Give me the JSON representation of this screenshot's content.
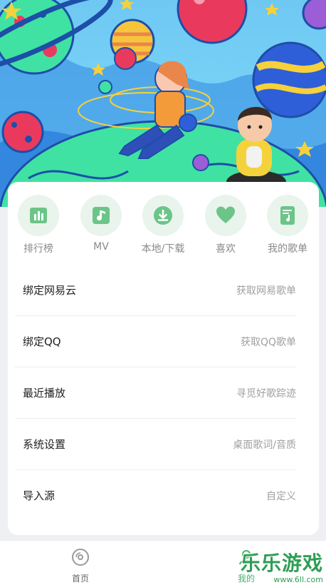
{
  "colors": {
    "accent": "#44b36a",
    "icon_bg": "#e9f4ec"
  },
  "hero": {
    "illustration": "space-planets-girl-and-3d-avatar"
  },
  "shortcuts": [
    {
      "label": "排行榜",
      "icon": "chart-icon"
    },
    {
      "label": "MV",
      "icon": "music-note-icon"
    },
    {
      "label": "本地/下载",
      "icon": "download-icon"
    },
    {
      "label": "喜欢",
      "icon": "heart-icon"
    },
    {
      "label": "我的歌单",
      "icon": "playlist-icon"
    }
  ],
  "menu": [
    {
      "title": "绑定网易云",
      "subtitle": "获取网易歌单"
    },
    {
      "title": "绑定QQ",
      "subtitle": "获取QQ歌单"
    },
    {
      "title": "最近播放",
      "subtitle": "寻觅好歌踪迹"
    },
    {
      "title": "系统设置",
      "subtitle": "桌面歌词/音质"
    },
    {
      "title": "导入源",
      "subtitle": "自定义"
    }
  ],
  "nav": [
    {
      "label": "首页",
      "icon": "disc-icon",
      "active": false
    },
    {
      "label": "我的",
      "icon": "user-icon",
      "active": true
    }
  ],
  "watermark": {
    "title": "乐乐游戏",
    "url": "www.6ll.com"
  }
}
